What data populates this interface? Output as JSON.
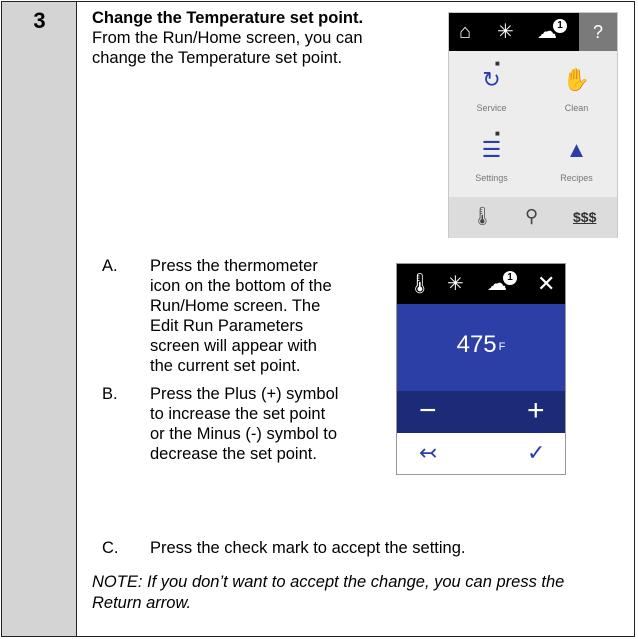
{
  "step_number": "3",
  "intro": {
    "bold": "Change the Temperature set point.",
    "text": " From the Run/Home screen, you can change the Temperature set point."
  },
  "screen_home": {
    "top_icons": [
      "home-icon",
      "snowflake-icon",
      "oven-alert-icon"
    ],
    "help_label": "?",
    "badge": "1",
    "tiles": [
      {
        "label": "Service",
        "icon": "wrench-icon",
        "locked": true
      },
      {
        "label": "Clean",
        "icon": "clean-hand-icon",
        "locked": false
      },
      {
        "label": "Settings",
        "icon": "list-icon",
        "locked": true
      },
      {
        "label": "Recipes",
        "icon": "cloche-icon",
        "locked": false
      }
    ],
    "bottom_icons": [
      "thermometer-icon",
      "probe-icon",
      "steam-icon"
    ],
    "steam_label": "$$$"
  },
  "steps": [
    {
      "letter": "A.",
      "text": "Press the thermometer icon on the bottom of the Run/Home screen. The Edit Run Parameters screen will appear with the current set point."
    },
    {
      "letter": "B.",
      "text": "Press the Plus (+) symbol to increase the set point or the Minus (-) symbol to decrease the set point."
    },
    {
      "letter": "C.",
      "text": "Press the check mark to accept the setting."
    }
  ],
  "screen_edit": {
    "badge": "1",
    "close_label": "✕",
    "temperature": "475",
    "unit": "F",
    "minus_label": "−",
    "plus_label": "+",
    "return_label": "↢",
    "check_label": "✓"
  },
  "note": "NOTE: If you don’t want to accept the change, you can press the Return arrow.",
  "colors": {
    "accent_blue": "#2b3fa6",
    "dark_blue": "#1c2b78",
    "sidebar_gray": "#d4d4d4"
  }
}
